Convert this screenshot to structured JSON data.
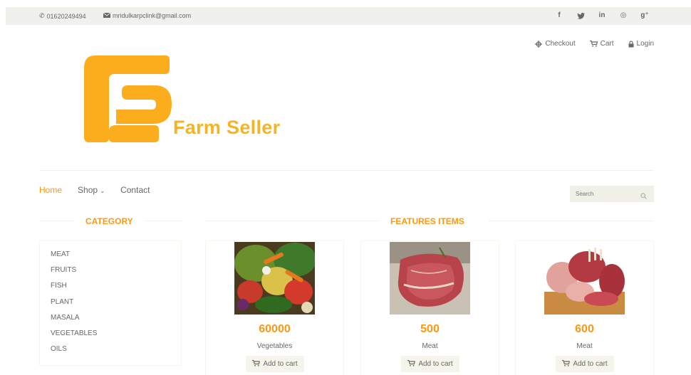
{
  "topbar": {
    "phone": "01620249494",
    "email": "mridulkarpclink@gmail.com",
    "social": [
      "f",
      "❦",
      "in",
      "◎",
      "g⁺"
    ]
  },
  "header_links": {
    "checkout": "Checkout",
    "cart": "Cart",
    "login": "Login"
  },
  "brand": {
    "name": "Farm Seller",
    "color": "#f5b428"
  },
  "nav": {
    "items": [
      {
        "label": "Home",
        "active": true
      },
      {
        "label": "Shop ⌵",
        "active": false
      },
      {
        "label": "Contact",
        "active": false
      }
    ],
    "search_placeholder": "Search"
  },
  "sections": {
    "category_title": "CATEGORY",
    "features_title": "FEATURES ITEMS"
  },
  "categories": [
    "MEAT",
    "FRUITS",
    "FISH",
    "PLANT",
    "MASALA",
    "VEGETABLES",
    "OILS"
  ],
  "products": [
    {
      "price": "60000",
      "name": "Vegetables",
      "button": "Add to cart",
      "image": "vegetables-photo"
    },
    {
      "price": "500",
      "name": "Meat",
      "button": "Add to cart",
      "image": "steak-photo"
    },
    {
      "price": "600",
      "name": "Meat",
      "button": "Add to cart",
      "image": "meat-cuts-photo"
    }
  ],
  "colors": {
    "accent": "#fe980f",
    "topbar_bg": "#f0f0ed",
    "text": "#696763"
  }
}
